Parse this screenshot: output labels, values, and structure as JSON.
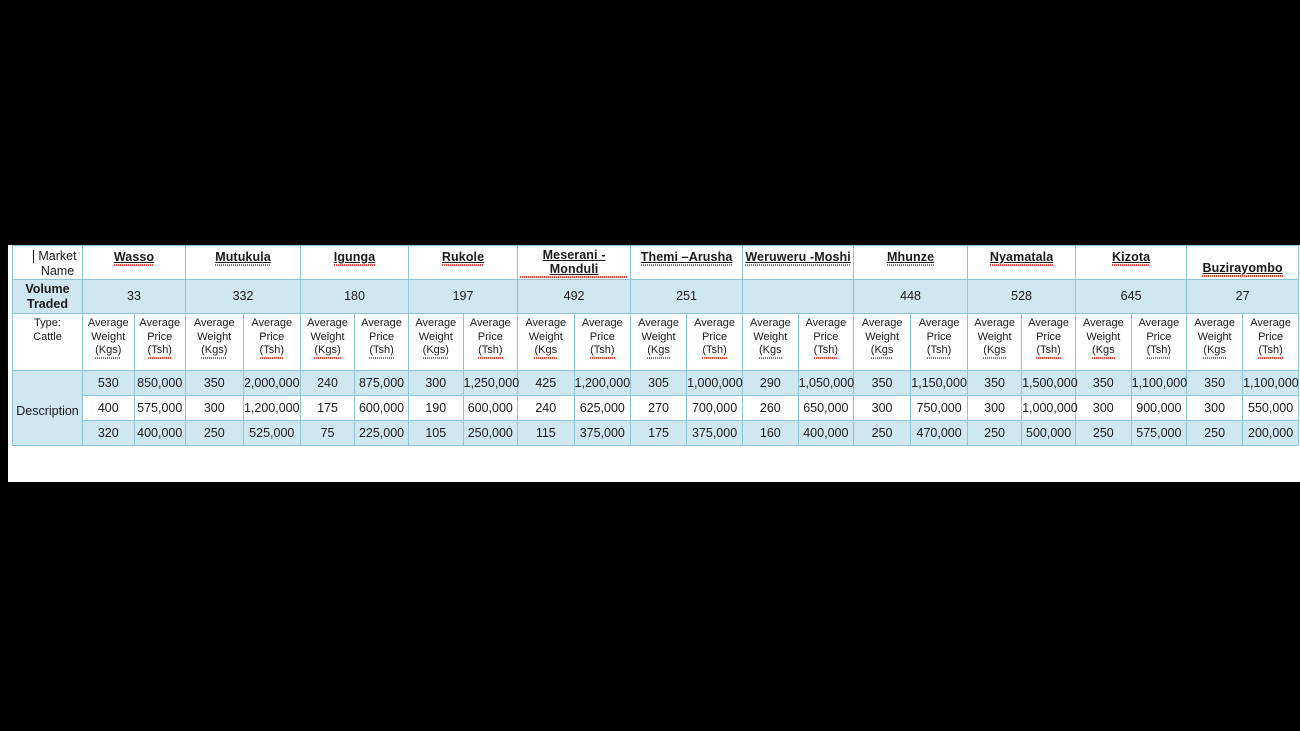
{
  "document": {
    "row_labels": {
      "market_name": "Market\nName",
      "volume_traded": "Volume\nTraded",
      "type": "Type:\nCattle",
      "description": "Description"
    },
    "sub_headers": {
      "weight": "Average Weight",
      "price": "Average Price",
      "weight_unit_closed": "(Kgs)",
      "weight_unit_open": "(Kgs",
      "price_unit": "(Tsh)"
    },
    "markets": [
      {
        "name": "Wasso",
        "volume": "33",
        "align": "top",
        "weight_unit": "(Kgs)",
        "price_unit": "(Tsh)",
        "rows": [
          {
            "weight": "530",
            "price": "850,000"
          },
          {
            "weight": "400",
            "price": "575,000"
          },
          {
            "weight": "320",
            "price": "400,000"
          }
        ]
      },
      {
        "name": "Mutukula",
        "volume": "332",
        "align": "top",
        "weight_unit": "(Kgs)",
        "price_unit": "(Tsh)",
        "divider": true,
        "rows": [
          {
            "weight": "350",
            "price": "2,000,000"
          },
          {
            "weight": "300",
            "price": "1,200,000"
          },
          {
            "weight": "250",
            "price": "525,000"
          }
        ]
      },
      {
        "name": "Igunga",
        "volume": "180",
        "align": "top",
        "weight_unit": "(Kgs)",
        "price_unit": "(Tsh)",
        "rows": [
          {
            "weight": "240",
            "price": "875,000"
          },
          {
            "weight": "175",
            "price": "600,000"
          },
          {
            "weight": "75",
            "price": "225,000"
          }
        ]
      },
      {
        "name": "Rukole",
        "volume": "197",
        "align": "top",
        "weight_unit": "(Kgs)",
        "price_unit": "(Tsh)",
        "rows": [
          {
            "weight": "300",
            "price": "1,250,000"
          },
          {
            "weight": "190",
            "price": "600,000"
          },
          {
            "weight": "105",
            "price": "250,000"
          }
        ]
      },
      {
        "name": "Meserani - Monduli",
        "volume": "492",
        "align": "top",
        "weight_unit": "(Kgs",
        "price_unit": "(Tsh)",
        "rows": [
          {
            "weight": "425",
            "price": "1,200,000"
          },
          {
            "weight": "240",
            "price": "625,000"
          },
          {
            "weight": "115",
            "price": "375,000"
          }
        ]
      },
      {
        "name": "Themi –Arusha",
        "volume": "251",
        "align": "top",
        "weight_unit": "(Kgs",
        "price_unit": "(Tsh)",
        "rows": [
          {
            "weight": "305",
            "price": "1,000,000"
          },
          {
            "weight": "270",
            "price": "700,000"
          },
          {
            "weight": "175",
            "price": "375,000"
          }
        ]
      },
      {
        "name": "Weruweru -Moshi",
        "volume": "",
        "align": "top",
        "weight_unit": "(Kgs",
        "price_unit": "(Tsh)",
        "rows": [
          {
            "weight": "290",
            "price": "1,050,000"
          },
          {
            "weight": "260",
            "price": "650,000"
          },
          {
            "weight": "160",
            "price": "400,000"
          }
        ]
      },
      {
        "name": "Mhunze",
        "volume": "448",
        "align": "top",
        "weight_unit": "(Kgs",
        "price_unit": "(Tsh)",
        "rows": [
          {
            "weight": "350",
            "price": "1,150,000"
          },
          {
            "weight": "300",
            "price": "750,000"
          },
          {
            "weight": "250",
            "price": "470,000"
          }
        ]
      },
      {
        "name": "Nyamatala",
        "volume": "528",
        "align": "top",
        "weight_unit": "(Kgs",
        "price_unit": "(Tsh)",
        "rows": [
          {
            "weight": "350",
            "price": "1,500,000"
          },
          {
            "weight": "300",
            "price": "1,000,000"
          },
          {
            "weight": "250",
            "price": "500,000"
          }
        ]
      },
      {
        "name": "Kizota",
        "volume": "645",
        "align": "top",
        "weight_unit": "(Kgs",
        "price_unit": "(Tsh)",
        "rows": [
          {
            "weight": "350",
            "price": "1,100,000"
          },
          {
            "weight": "300",
            "price": "900,000"
          },
          {
            "weight": "250",
            "price": "575,000"
          }
        ]
      },
      {
        "name": "Buzirayombo",
        "volume": "27",
        "align": "bottom",
        "weight_unit": "(Kgs",
        "price_unit": "(Tsh)",
        "rows": [
          {
            "weight": "350",
            "price": "1,100,000"
          },
          {
            "weight": "300",
            "price": "550,000"
          },
          {
            "weight": "250",
            "price": "200,000"
          }
        ]
      }
    ]
  },
  "colors": {
    "fill_blue": "#cee7f0",
    "border_blue": "#8ec4d8",
    "spellcheck_red": "#e8453c",
    "page_background": "#000000",
    "slab": "#ffffff"
  }
}
